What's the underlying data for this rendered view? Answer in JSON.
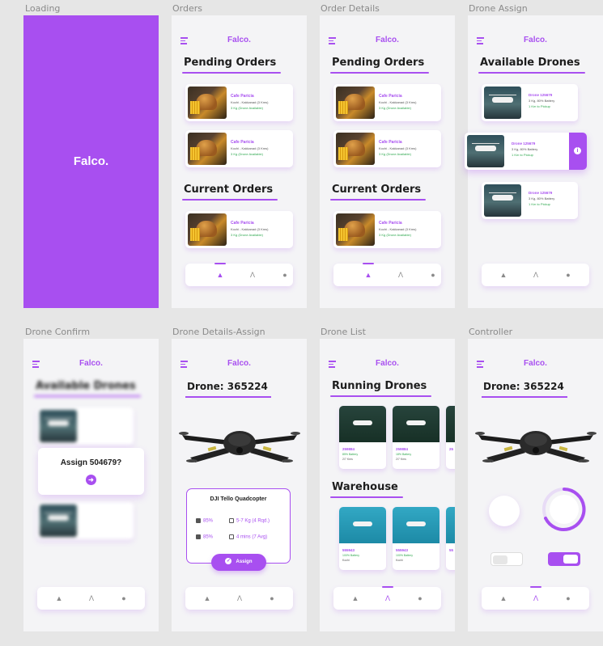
{
  "frames": [
    {
      "label": "Loading"
    },
    {
      "label": "Orders"
    },
    {
      "label": "Order Details"
    },
    {
      "label": "Drone Assign"
    },
    {
      "label": "Drone Confirm"
    },
    {
      "label": "Drone Details-Assign"
    },
    {
      "label": "Drone List"
    },
    {
      "label": "Controller"
    }
  ],
  "app": {
    "logo": "Falco.",
    "accent": "#a84ff0"
  },
  "orders": {
    "pending_title": "Pending Orders",
    "current_title": "Current Orders",
    "card": {
      "name": "Cafe Paricia",
      "location": "Kochi - Kakkanad (3 Kms)",
      "weight": "3 Kg (Drone Available)"
    }
  },
  "drone_assign": {
    "title": "Available Drones",
    "card": {
      "name": "Drone 125679",
      "info": "3 Kg, 80% Battery",
      "pickup": "1 Km to Pickup"
    },
    "info_icon": "info-icon"
  },
  "drone_confirm": {
    "title": "Available Drones",
    "dialog_text": "Assign 504679?"
  },
  "drone_details": {
    "title": "Drone: 365224",
    "model": "DJI Tello Quadcopter",
    "specs": [
      {
        "value": "85%"
      },
      {
        "value": "5-7 Kg (4 Rqd.)"
      },
      {
        "value": "85%"
      },
      {
        "value": "4 mins (7 Avg)"
      }
    ],
    "assign_label": "Assign"
  },
  "drone_list": {
    "running_title": "Running Drones",
    "warehouse_title": "Warehouse",
    "running": [
      {
        "id": "259884",
        "battery": "85% Battery",
        "dist": "2/7 Kms"
      },
      {
        "id": "259884",
        "battery": "18% Battery",
        "dist": "2/7 Kms"
      },
      {
        "id": "25"
      }
    ],
    "warehouse": [
      {
        "id": "555943",
        "battery": "100% Battery",
        "dist": "Kochi"
      },
      {
        "id": "555943",
        "battery": "100% Battery",
        "dist": "Kochi"
      },
      {
        "id": "55"
      }
    ]
  },
  "controller": {
    "title": "Drone: 365224"
  }
}
